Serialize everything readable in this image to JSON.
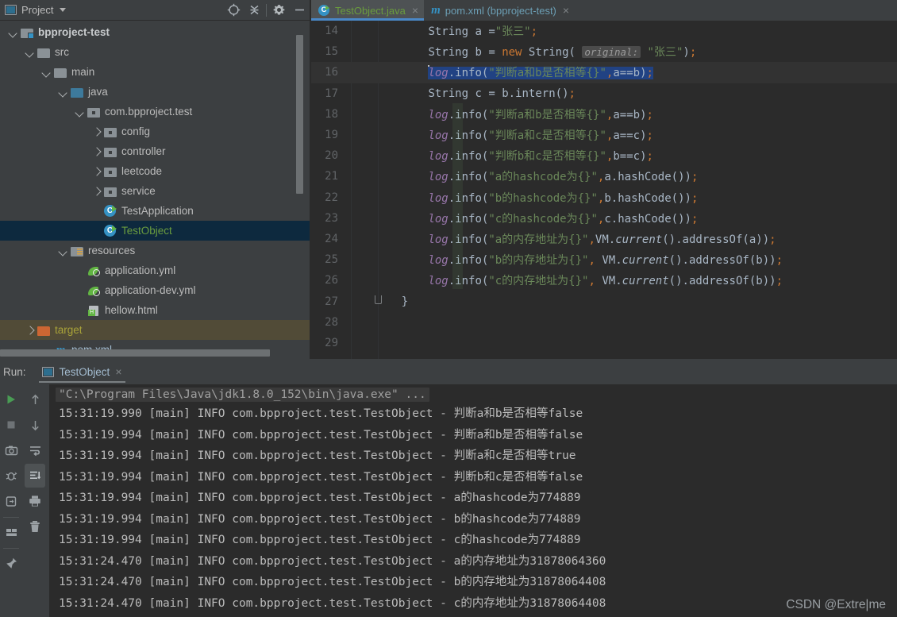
{
  "project_panel": {
    "title": "Project",
    "icons": [
      "target-icon",
      "collapse-all-icon",
      "gear-icon",
      "minimize-icon"
    ],
    "tree": [
      {
        "label": "bpproject-test",
        "indent": 0,
        "arrow": "down",
        "icon": "module-folder-icon",
        "style": "bold",
        "selected": false
      },
      {
        "label": "src",
        "indent": 1,
        "arrow": "down",
        "icon": "folder-icon",
        "style": "normal",
        "selected": false
      },
      {
        "label": "main",
        "indent": 2,
        "arrow": "down",
        "icon": "folder-icon",
        "style": "normal",
        "selected": false
      },
      {
        "label": "java",
        "indent": 3,
        "arrow": "down",
        "icon": "sources-folder-icon",
        "style": "normal",
        "selected": false
      },
      {
        "label": "com.bpproject.test",
        "indent": 4,
        "arrow": "down",
        "icon": "package-icon",
        "style": "normal",
        "selected": false
      },
      {
        "label": "config",
        "indent": 5,
        "arrow": "right",
        "icon": "package-icon",
        "style": "normal",
        "selected": false
      },
      {
        "label": "controller",
        "indent": 5,
        "arrow": "right",
        "icon": "package-icon",
        "style": "normal",
        "selected": false
      },
      {
        "label": "leetcode",
        "indent": 5,
        "arrow": "right",
        "icon": "package-icon",
        "style": "normal",
        "selected": false
      },
      {
        "label": "service",
        "indent": 5,
        "arrow": "right",
        "icon": "package-icon",
        "style": "normal",
        "selected": false
      },
      {
        "label": "TestApplication",
        "indent": 5,
        "arrow": "none",
        "icon": "java-class-icon",
        "style": "normal",
        "selected": false
      },
      {
        "label": "TestObject",
        "indent": 5,
        "arrow": "none",
        "icon": "java-class-icon",
        "style": "green",
        "selected": true
      },
      {
        "label": "resources",
        "indent": 3,
        "arrow": "down",
        "icon": "resources-folder-icon",
        "style": "normal",
        "selected": false
      },
      {
        "label": "application.yml",
        "indent": 4,
        "arrow": "none",
        "icon": "yml-icon",
        "style": "normal",
        "selected": false
      },
      {
        "label": "application-dev.yml",
        "indent": 4,
        "arrow": "none",
        "icon": "yml-icon",
        "style": "normal",
        "selected": false
      },
      {
        "label": "hellow.html",
        "indent": 4,
        "arrow": "none",
        "icon": "html-icon",
        "style": "normal",
        "selected": false
      },
      {
        "label": "target",
        "indent": 1,
        "arrow": "right",
        "icon": "target-folder-icon",
        "style": "yellowish",
        "selected": false
      },
      {
        "label": "pom.xml",
        "indent": 2,
        "arrow": "none",
        "icon": "maven-icon",
        "style": "blueish",
        "selected": false
      }
    ]
  },
  "editor": {
    "tabs": [
      {
        "label": "TestObject.java",
        "icon": "java-class-icon",
        "active": true,
        "color": "green"
      },
      {
        "label": "pom.xml (bpproject-test)",
        "icon": "maven-icon",
        "active": false,
        "color": "blue"
      }
    ],
    "close_glyph": "×",
    "current_line": 16,
    "lines": [
      {
        "no": "14",
        "text": "        String a =\"张三\";"
      },
      {
        "no": "15",
        "text": "        String b = new String( original: \"张三\");",
        "hint": "original:"
      },
      {
        "no": "16",
        "text": "        log.info(\"判断a和b是否相等{}\",a==b);",
        "selected": true
      },
      {
        "no": "17",
        "text": "        String c = b.intern();"
      },
      {
        "no": "18",
        "text": "        log.info(\"判断a和b是否相等{}\",a==b);"
      },
      {
        "no": "19",
        "text": "        log.info(\"判断a和c是否相等{}\",a==c);"
      },
      {
        "no": "20",
        "text": "        log.info(\"判断b和c是否相等{}\",b==c);"
      },
      {
        "no": "21",
        "text": "        log.info(\"a的hashcode为{}\",a.hashCode());"
      },
      {
        "no": "22",
        "text": "        log.info(\"b的hashcode为{}\",b.hashCode());"
      },
      {
        "no": "23",
        "text": "        log.info(\"c的hashcode为{}\",c.hashCode());"
      },
      {
        "no": "24",
        "text": "        log.info(\"a的内存地址为{}\",VM.current().addressOf(a));"
      },
      {
        "no": "25",
        "text": "        log.info(\"b的内存地址为{}\", VM.current().addressOf(b));"
      },
      {
        "no": "26",
        "text": "        log.info(\"c的内存地址为{}\", VM.current().addressOf(b));"
      },
      {
        "no": "27",
        "text": "    }"
      },
      {
        "no": "28",
        "text": ""
      },
      {
        "no": "29",
        "text": ""
      }
    ]
  },
  "run_panel": {
    "label": "Run:",
    "tab_label": "TestObject",
    "close_glyph": "×",
    "toolbar_left": [
      "run-icon",
      "stop-icon",
      "camera-icon",
      "debug-icon",
      "rerun-icon",
      "layout-icon",
      "pin-icon"
    ],
    "toolbar_right": [
      "scroll-up-icon",
      "scroll-down-icon",
      "soft-wrap-icon",
      "scroll-to-end-icon",
      "print-icon",
      "trash-icon"
    ],
    "command": "\"C:\\Program Files\\Java\\jdk1.8.0_152\\bin\\java.exe\" ...",
    "lines": [
      "15:31:19.990 [main] INFO com.bpproject.test.TestObject - 判断a和b是否相等false",
      "15:31:19.994 [main] INFO com.bpproject.test.TestObject - 判断a和b是否相等false",
      "15:31:19.994 [main] INFO com.bpproject.test.TestObject - 判断a和c是否相等true",
      "15:31:19.994 [main] INFO com.bpproject.test.TestObject - 判断b和c是否相等false",
      "15:31:19.994 [main] INFO com.bpproject.test.TestObject - a的hashcode为774889",
      "15:31:19.994 [main] INFO com.bpproject.test.TestObject - b的hashcode为774889",
      "15:31:19.994 [main] INFO com.bpproject.test.TestObject - c的hashcode为774889",
      "15:31:24.470 [main] INFO com.bpproject.test.TestObject - a的内存地址为31878064360",
      "15:31:24.470 [main] INFO com.bpproject.test.TestObject - b的内存地址为31878064408",
      "15:31:24.470 [main] INFO com.bpproject.test.TestObject - c的内存地址为31878064408"
    ]
  },
  "watermark": "CSDN @Extre|me",
  "colors": {
    "panel_bg": "#3c3f41",
    "editor_bg": "#2b2b2b",
    "selection": "#214283",
    "tree_selection": "#0d293e",
    "target_row": "#514b37",
    "accent_blue": "#4a88c7",
    "string_green": "#6a8759",
    "keyword_orange": "#cc7832",
    "field_purple": "#9876aa"
  }
}
